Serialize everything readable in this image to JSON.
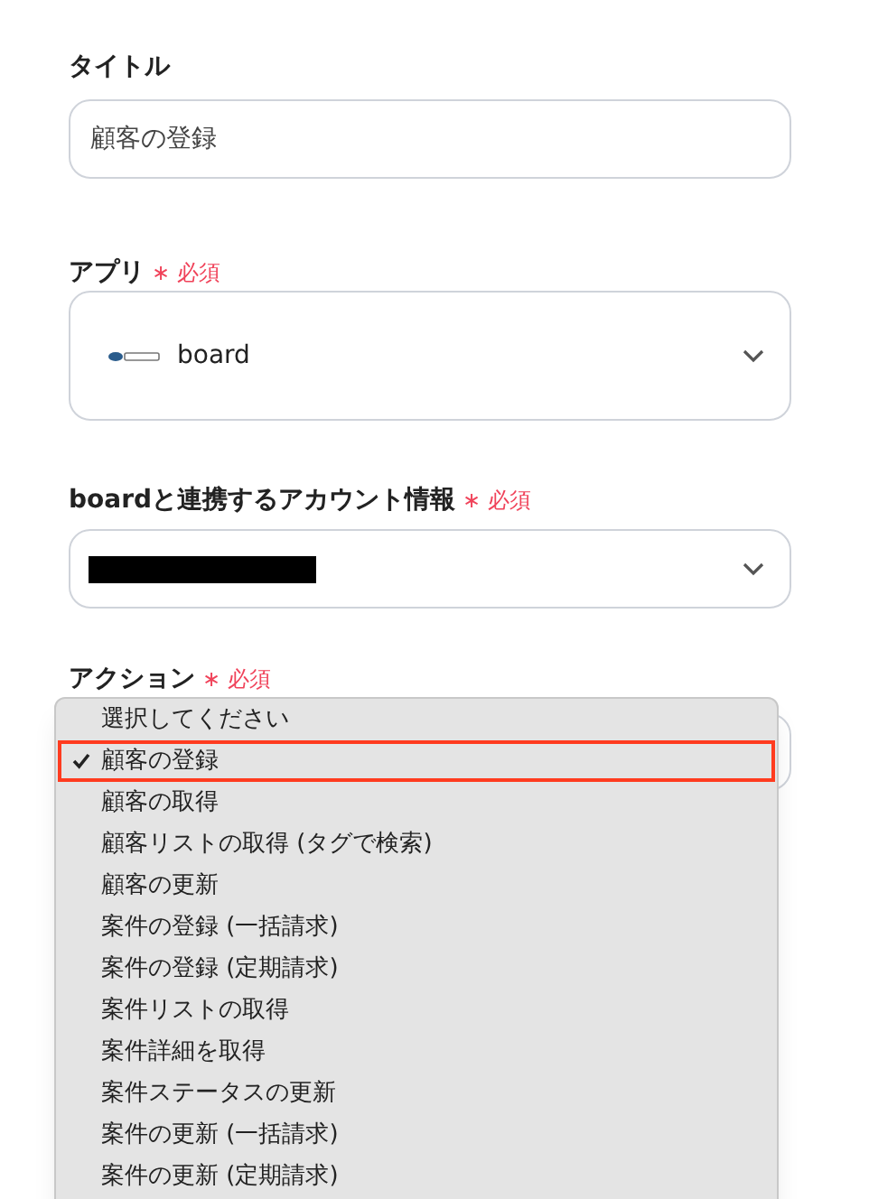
{
  "title_field": {
    "label": "タイトル",
    "value": "顧客の登録"
  },
  "app_field": {
    "label": "アプリ",
    "required_mark": "∗",
    "required": "必須",
    "value": "board"
  },
  "account_field": {
    "label": "boardと連携するアカウント情報",
    "required_mark": "∗",
    "required": "必須"
  },
  "action_field": {
    "label": "アクション",
    "required_mark": "∗",
    "required": "必須"
  },
  "action_menu": [
    {
      "label": "選択してください",
      "selected": false
    },
    {
      "label": "顧客の登録",
      "selected": true
    },
    {
      "label": "顧客の取得",
      "selected": false
    },
    {
      "label": "顧客リストの取得 (タグで検索)",
      "selected": false
    },
    {
      "label": "顧客の更新",
      "selected": false
    },
    {
      "label": "案件の登録 (一括請求)",
      "selected": false
    },
    {
      "label": "案件の登録 (定期請求)",
      "selected": false
    },
    {
      "label": "案件リストの取得",
      "selected": false
    },
    {
      "label": "案件詳細を取得",
      "selected": false
    },
    {
      "label": "案件ステータスの更新",
      "selected": false
    },
    {
      "label": "案件の更新 (一括請求)",
      "selected": false
    },
    {
      "label": "案件の更新 (定期請求)",
      "selected": false
    }
  ]
}
